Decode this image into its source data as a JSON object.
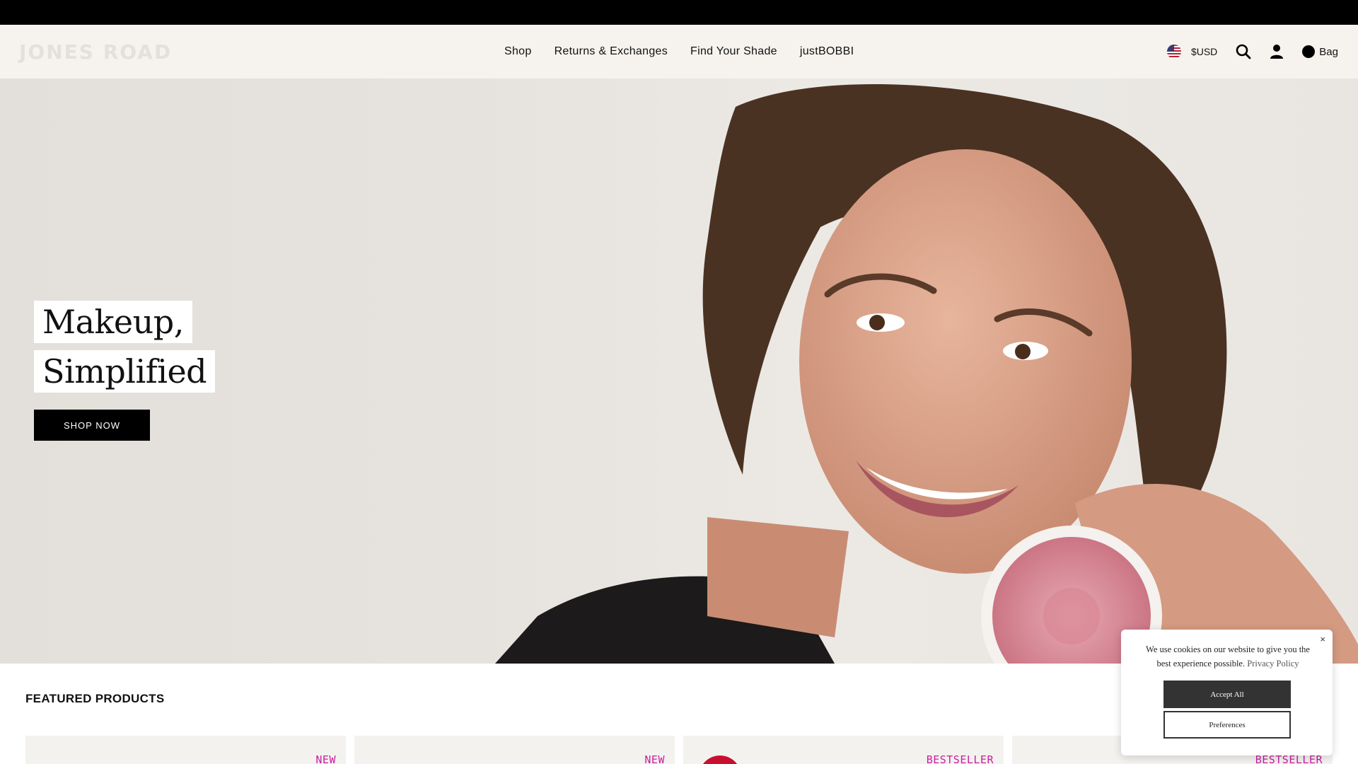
{
  "header": {
    "logo": "JONES ROAD",
    "nav": [
      "Shop",
      "Returns & Exchanges",
      "Find Your Shade",
      "justBOBBI"
    ],
    "currency": "$USD",
    "bag_label": "Bag"
  },
  "hero": {
    "headline_1": "Makeup,",
    "headline_2": "Simplified",
    "cta": "SHOP NOW"
  },
  "featured": {
    "title": "FEATURED PRODUCTS",
    "cards": [
      {
        "badge": "NEW"
      },
      {
        "badge": "NEW"
      },
      {
        "badge": "BESTSELLER"
      },
      {
        "badge": "BESTSELLER"
      }
    ]
  },
  "cookie": {
    "close": "×",
    "text": "We use cookies on our website to give you the best experience possible.",
    "link": "Privacy Policy",
    "accept": "Accept All",
    "preferences": "Preferences"
  },
  "colors": {
    "announcement_bar": "#000000",
    "header_bg": "#f6f3ee",
    "badge": "#c81ea0",
    "cta_bg": "#000000"
  },
  "icons": [
    "us-flag-icon",
    "search-icon",
    "account-icon",
    "bag-icon",
    "close-icon"
  ]
}
